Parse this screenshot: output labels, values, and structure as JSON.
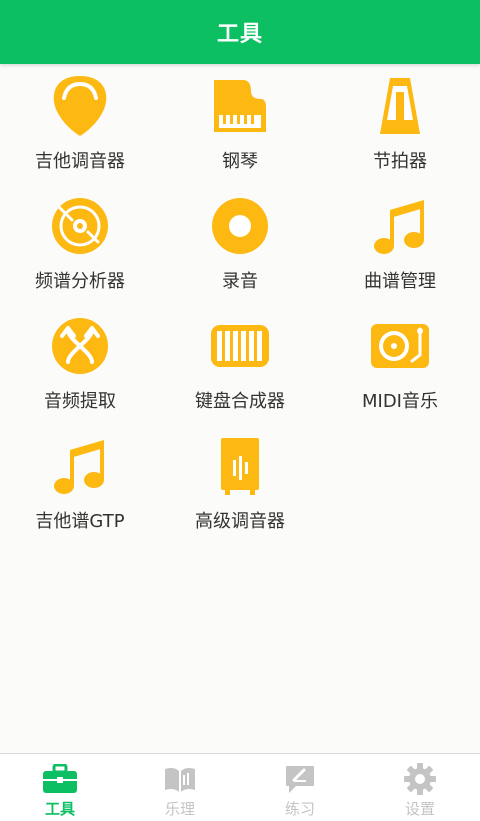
{
  "header": {
    "title": "工具"
  },
  "tools": [
    {
      "label": "吉他调音器",
      "icon": "guitar-pick-icon"
    },
    {
      "label": "钢琴",
      "icon": "piano-icon"
    },
    {
      "label": "节拍器",
      "icon": "metronome-icon"
    },
    {
      "label": "频谱分析器",
      "icon": "vinyl-disc-icon"
    },
    {
      "label": "录音",
      "icon": "record-icon"
    },
    {
      "label": "曲谱管理",
      "icon": "music-note-icon"
    },
    {
      "label": "音频提取",
      "icon": "audio-extract-icon"
    },
    {
      "label": "键盘合成器",
      "icon": "keyboard-synth-icon"
    },
    {
      "label": "MIDI音乐",
      "icon": "turntable-icon"
    },
    {
      "label": "吉他谱GTP",
      "icon": "music-note-icon"
    },
    {
      "label": "高级调音器",
      "icon": "speaker-tuner-icon"
    }
  ],
  "tabbar": {
    "items": [
      {
        "label": "工具",
        "icon": "toolbox-icon",
        "active": true
      },
      {
        "label": "乐理",
        "icon": "open-book-icon",
        "active": false
      },
      {
        "label": "练习",
        "icon": "edit-chat-icon",
        "active": false
      },
      {
        "label": "设置",
        "icon": "gear-icon",
        "active": false
      }
    ]
  },
  "colors": {
    "primary_green": "#0dbf63",
    "icon_orange": "#fdb812",
    "inactive_gray": "#c4c4c4"
  }
}
